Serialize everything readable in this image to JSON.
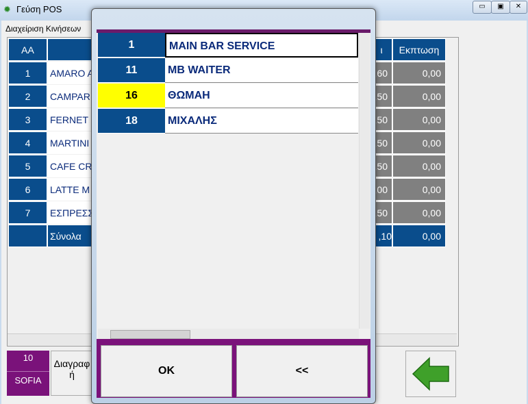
{
  "window": {
    "title": "Γεύση POS",
    "subtitle": "Διαχείριση Κινήσεων"
  },
  "grid": {
    "headers": [
      "AA",
      "",
      "ι",
      "Εκπτωση"
    ],
    "rows": [
      {
        "aa": "1",
        "name": "AMARO A",
        "amt": ",60",
        "disc": "0,00"
      },
      {
        "aa": "2",
        "name": "CAMPARI",
        "amt": ",50",
        "disc": "0,00"
      },
      {
        "aa": "3",
        "name": "FERNET",
        "amt": ",50",
        "disc": "0,00"
      },
      {
        "aa": "4",
        "name": "MARTINI",
        "amt": ",50",
        "disc": "0,00"
      },
      {
        "aa": "5",
        "name": "CAFE CR",
        "amt": ",50",
        "disc": "0,00"
      },
      {
        "aa": "6",
        "name": "LATTE M",
        "amt": ",00",
        "disc": "0,00"
      },
      {
        "aa": "7",
        "name": "ΕΣΠΡΕΣΣ",
        "amt": ",50",
        "disc": "0,00"
      }
    ],
    "totals": {
      "label": "Σύνολα",
      "amt": ",10",
      "disc": "0,00"
    }
  },
  "user": {
    "id": "10",
    "name": "SOFIA"
  },
  "delete_button": "Διαγραφ ή",
  "dialog": {
    "items": [
      {
        "num": "1",
        "name": "MAIN BAR SERVICE",
        "highlight": false
      },
      {
        "num": "11",
        "name": "MB WAITER",
        "highlight": false
      },
      {
        "num": "16",
        "name": "ΘΩΜΑΗ",
        "highlight": true
      },
      {
        "num": "18",
        "name": "ΜΙΧΑΛΗΣ",
        "highlight": false
      }
    ],
    "ok": "OK",
    "back": "<<"
  },
  "colors": {
    "blue": "#0a4d8c",
    "purple": "#7a127a",
    "highlight": "#ffff00"
  }
}
